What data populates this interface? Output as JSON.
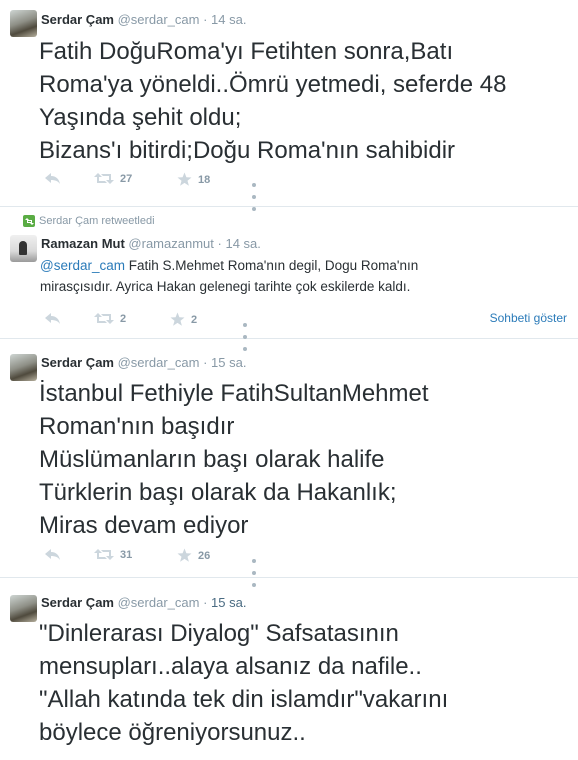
{
  "tweets": [
    {
      "name": "Serdar Çam",
      "handle": "@serdar_cam",
      "time": "14 sa.",
      "text": "Fatih DoğuRoma'yı Fetihten sonra,Batı\nRoma'ya yöneldi..Ömrü yetmedi, seferde 48\nYaşında şehit oldu;\nBizans'ı bitirdi;Doğu Roma'nın sahibidir",
      "retweets": "27",
      "favorites": "18"
    },
    {
      "retweet_context": "Serdar Çam retweetledi",
      "name": "Ramazan Mut",
      "handle": "@ramazanmut",
      "time": "14 sa.",
      "mention": "@serdar_cam",
      "text": " Fatih S.Mehmet Roma'nın degil, Dogu Roma'nın\nmirasçısıdır. Ayrica Hakan gelenegi tarihte çok eskilerde kaldı.",
      "retweets": "2",
      "favorites": "2",
      "conversation_link": "Sohbeti göster"
    },
    {
      "name": "Serdar Çam",
      "handle": "@serdar_cam",
      "time": "15 sa.",
      "text": "İstanbul Fethiyle FatihSultanMehmet\nRoman'nın başıdır\nMüslümanların başı olarak halife\nTürklerin başı olarak da Hakanlık;\nMiras devam ediyor",
      "retweets": "31",
      "favorites": "26"
    },
    {
      "name": "Serdar Çam",
      "handle": "@serdar_cam",
      "time": "15 sa.",
      "text": "\"Dinlerarası Diyalog\" Safsatasının\nmensupları..alaya alsanız da nafile..\n\"Allah katında tek din islamdır\"vakarını\nböylece öğreniyorsunuz.."
    }
  ],
  "colors": {
    "link": "#2b7bb9",
    "meta": "#8899a6",
    "text": "#292f33",
    "retweet_green": "#5aac44"
  }
}
